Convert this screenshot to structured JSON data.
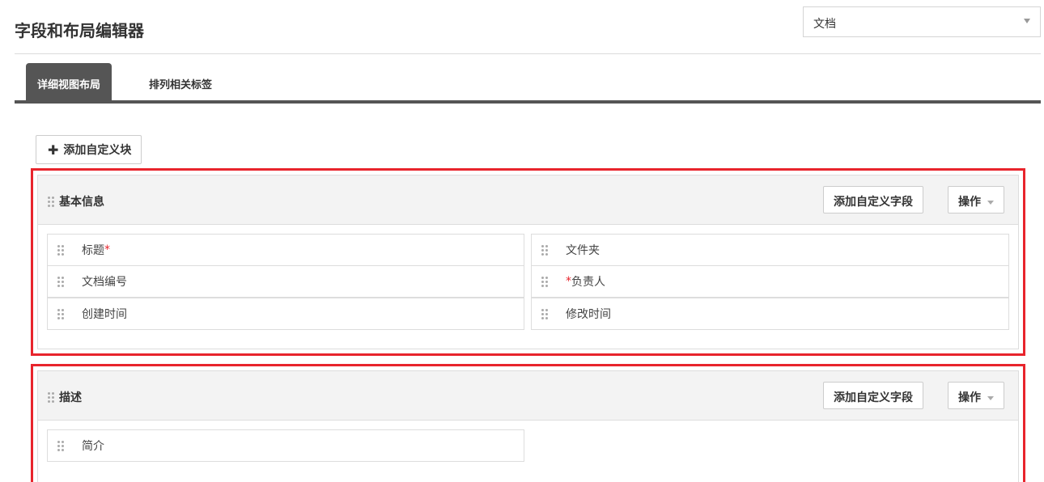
{
  "header": {
    "title": "字段和布局编辑器",
    "module_select": "文档"
  },
  "tabs": [
    {
      "label": "详细视图布局"
    },
    {
      "label": "排列相关标签"
    }
  ],
  "toolbar": {
    "add_block_label": "添加自定义块"
  },
  "blocks": [
    {
      "title": "基本信息",
      "add_field_label": "添加自定义字段",
      "actions_label": "操作",
      "fields": [
        {
          "label": "标题",
          "required_mark": "*"
        },
        {
          "label": "文件夹"
        },
        {
          "label": "文档编号"
        },
        {
          "label": "负责人",
          "required_mark": "*"
        },
        {
          "label": "创建时间"
        },
        {
          "label": "修改时间"
        }
      ]
    },
    {
      "title": "描述",
      "add_field_label": "添加自定义字段",
      "actions_label": "操作",
      "fields": [
        {
          "label": "简介"
        }
      ]
    }
  ],
  "colors": {
    "highlight": "#e8242c",
    "tab_active": "#555555",
    "required": "#e8242c"
  },
  "icons": {
    "add": "plus-icon",
    "drag": "drag-handle-icon",
    "dropdown": "chevron-down-icon"
  }
}
